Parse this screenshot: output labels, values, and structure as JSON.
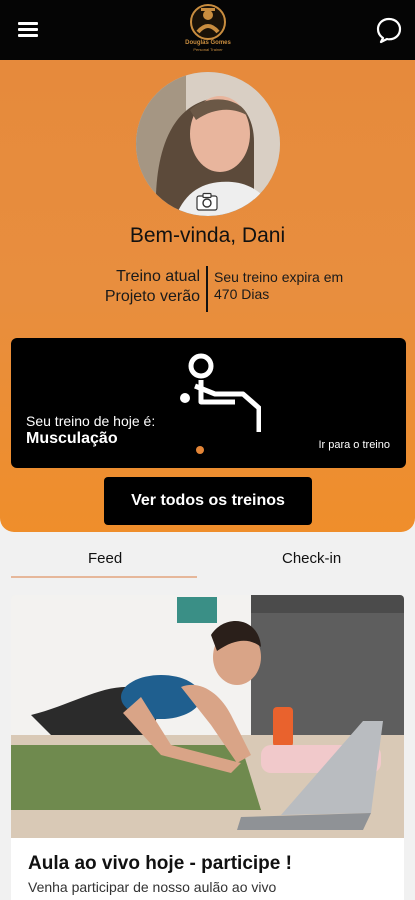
{
  "header": {
    "logo_text": "Douglas Gomes",
    "logo_subtext": "Personal Trainer",
    "icons": {
      "menu": "hamburger-icon",
      "chat": "chat-bubble-icon",
      "camera": "camera-icon"
    }
  },
  "profile": {
    "greeting": "Bem-vinda, Dani",
    "plan_label": "Treino atual",
    "plan_name": "Projeto verão",
    "expires_label": "Seu treino expira em",
    "expires_value": "470 Dias"
  },
  "today": {
    "label": "Seu treino de hoje é:",
    "workout": "Musculação",
    "go_link": "Ir para o treino",
    "icon": "weight-bench-icon"
  },
  "actions": {
    "all_workouts": "Ver todos os treinos"
  },
  "tabs": [
    {
      "label": "Feed",
      "active": true
    },
    {
      "label": "Check-in",
      "active": false
    }
  ],
  "feed": {
    "post_title": "Aula ao vivo hoje - participe !",
    "post_desc": "Venha participar de nosso aulão ao vivo"
  },
  "colors": {
    "accent": "#e88e3e",
    "header_bg": "#050505",
    "card_bg": "#000000",
    "tab_underline": "#e6b79a"
  }
}
